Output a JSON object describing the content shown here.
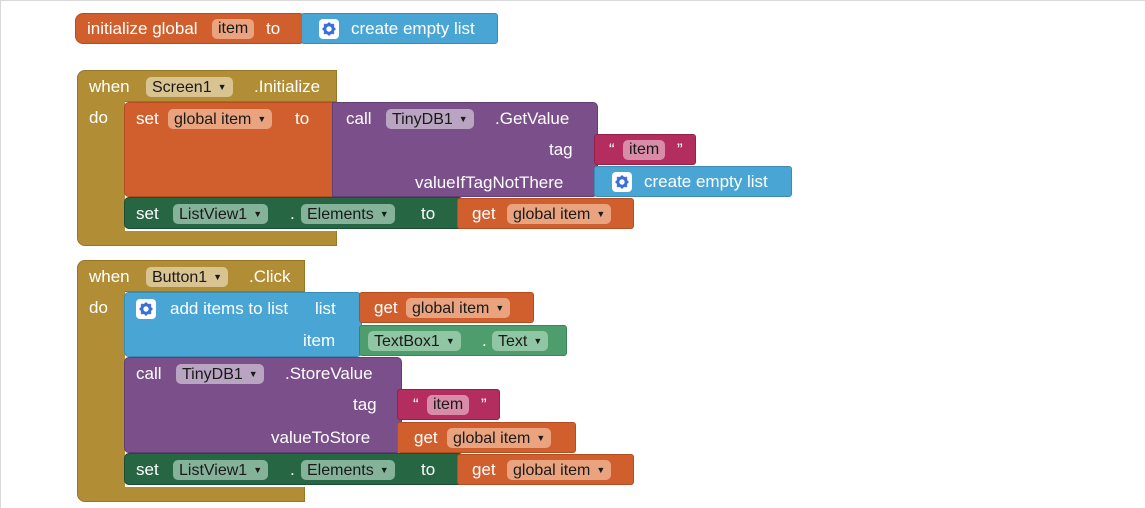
{
  "colors": {
    "variables": "#d05f2d",
    "lists": "#49a6d4",
    "control": "#b18e35",
    "tinydb": "#7a4f8a",
    "components": "#266643",
    "text": "#b32d5e",
    "textbox": "#4d9e6c"
  },
  "init_global": {
    "label": "initialize global",
    "name": "item",
    "to": "to",
    "value_icon": "gear-icon",
    "value": "create empty list"
  },
  "screen_event": {
    "when": "when",
    "component": "Screen1",
    "event": ".Initialize",
    "do": "do",
    "set_var": {
      "set": "set",
      "var": "global item",
      "to": "to",
      "call": "call",
      "db": "TinyDB1",
      "method": ".GetValue",
      "tag_label": "tag",
      "tag_open": "“",
      "tag_value": "item",
      "tag_close": "”",
      "default_label": "valueIfTagNotThere",
      "default_value": "create empty list"
    },
    "set_list": {
      "set": "set",
      "component": "ListView1",
      "dot": ".",
      "property": "Elements",
      "to": "to",
      "get": "get",
      "var": "global item"
    }
  },
  "button_event": {
    "when": "when",
    "component": "Button1",
    "event": ".Click",
    "do": "do",
    "add_items": {
      "label": "add items to list",
      "list_label": "list",
      "get": "get",
      "var": "global item",
      "item_label": "item",
      "textbox": "TextBox1",
      "dot": ".",
      "textbox_prop": "Text"
    },
    "store": {
      "call": "call",
      "db": "TinyDB1",
      "method": ".StoreValue",
      "tag_label": "tag",
      "tag_open": "“",
      "tag_value": "item",
      "tag_close": "”",
      "value_label": "valueToStore",
      "get": "get",
      "var": "global item"
    },
    "set_list": {
      "set": "set",
      "component": "ListView1",
      "dot": ".",
      "property": "Elements",
      "to": "to",
      "get": "get",
      "var": "global item"
    }
  }
}
